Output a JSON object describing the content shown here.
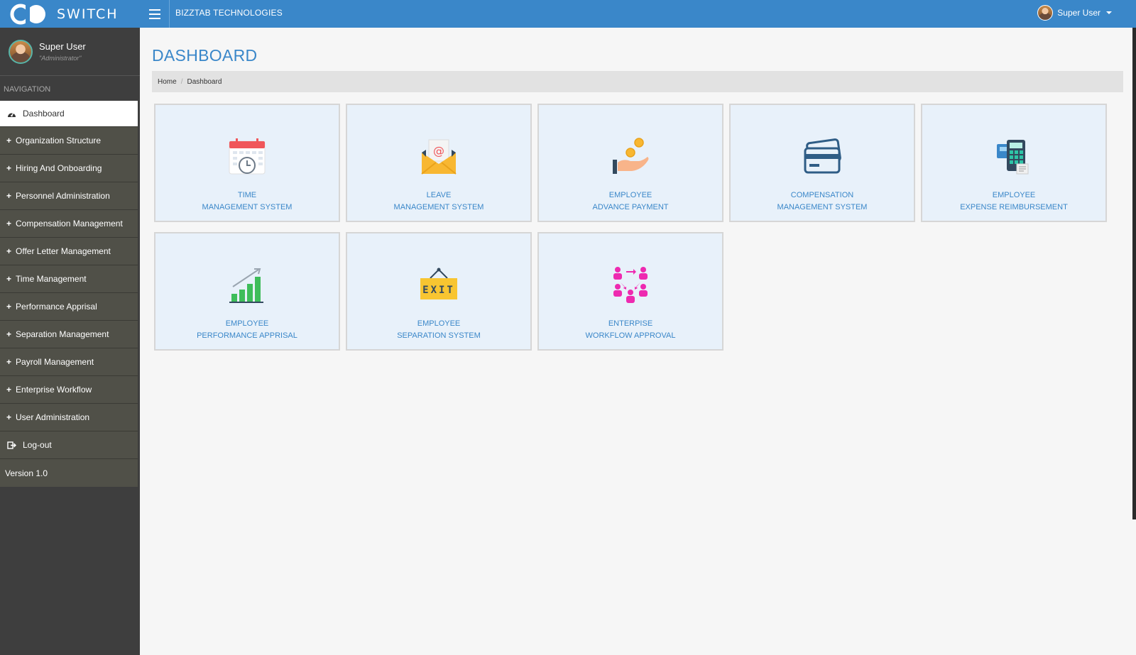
{
  "header": {
    "brand": "SWITCH",
    "company": "BIZZTAB TECHNOLOGIES",
    "user_name": "Super User"
  },
  "sidebar": {
    "profile_name": "Super User",
    "profile_role": "\"Administrator\"",
    "nav_heading": "NAVIGATION",
    "items": [
      {
        "label": "Dashboard",
        "icon": "dashboard-icon"
      },
      {
        "label": "Organization Structure"
      },
      {
        "label": "Hiring And Onboarding"
      },
      {
        "label": "Personnel Administration"
      },
      {
        "label": "Compensation Management"
      },
      {
        "label": "Offer Letter Management"
      },
      {
        "label": "Time Management"
      },
      {
        "label": "Performance Apprisal"
      },
      {
        "label": "Separation Management"
      },
      {
        "label": "Payroll Management"
      },
      {
        "label": "Enterprise Workflow"
      },
      {
        "label": "User Administration"
      },
      {
        "label": "Log-out",
        "icon": "logout-icon"
      }
    ],
    "version": "Version 1.0"
  },
  "main": {
    "title": "DASHBOARD",
    "breadcrumb": [
      "Home",
      "Dashboard"
    ],
    "tiles": [
      {
        "line1": "TIME",
        "line2": "MANAGEMENT SYSTEM",
        "icon": "calendar-clock-icon"
      },
      {
        "line1": "LEAVE",
        "line2": "MANAGEMENT SYSTEM",
        "icon": "email-envelope-icon"
      },
      {
        "line1": "EMPLOYEE",
        "line2": "ADVANCE PAYMENT",
        "icon": "hand-coins-icon"
      },
      {
        "line1": "COMPENSATION",
        "line2": "MANAGEMENT SYSTEM",
        "icon": "credit-card-icon"
      },
      {
        "line1": "EMPLOYEE",
        "line2": "EXPENSE REIMBURSEMENT",
        "icon": "calculator-receipt-icon"
      },
      {
        "line1": "EMPLOYEE",
        "line2": "PERFORMANCE APPRISAL",
        "icon": "growth-chart-icon"
      },
      {
        "line1": "EMPLOYEE",
        "line2": "SEPARATION SYSTEM",
        "icon": "exit-sign-icon",
        "sign_text": "EXIT"
      },
      {
        "line1": "ENTERPISE",
        "line2": "WORKFLOW APPROVAL",
        "icon": "workflow-people-icon"
      }
    ]
  },
  "colors": {
    "header_blue": "#3a87c9",
    "sidebar_dark": "#3e3e3e",
    "nav_item": "#505048",
    "tile_bg": "#e8f1fa"
  }
}
